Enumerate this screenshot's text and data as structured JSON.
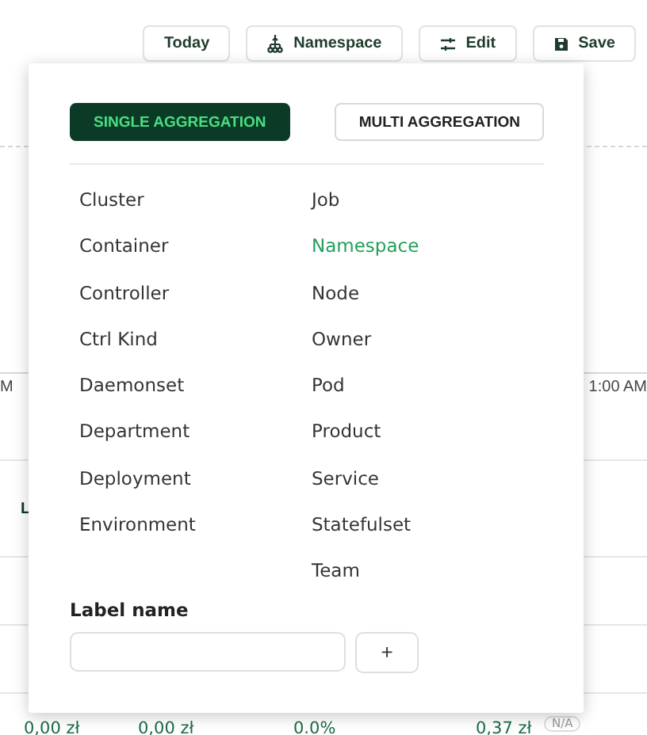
{
  "toolbar": [
    {
      "label": "Today"
    },
    {
      "label": "Namespace"
    },
    {
      "label": "Edit"
    },
    {
      "label": "Save"
    }
  ],
  "chart_axis": {
    "left_label": "M",
    "right_label": "1:00 AM"
  },
  "table": {
    "rows": [
      {
        "cells": [
          "L"
        ]
      },
      {
        "cells": [
          "0,00 zł",
          "0,00 zł",
          "0.0%",
          "0,37 zł"
        ],
        "badge": "N/A"
      }
    ]
  },
  "popup": {
    "modes": [
      {
        "label": "SINGLE AGGREGATION",
        "selected": true
      },
      {
        "label": "MULTI AGGREGATION",
        "selected": false
      }
    ],
    "columns": [
      [
        {
          "label": "Cluster",
          "selected": false
        },
        {
          "label": "Container",
          "selected": false
        },
        {
          "label": "Controller",
          "selected": false
        },
        {
          "label": "Ctrl Kind",
          "selected": false
        },
        {
          "label": "Daemonset",
          "selected": false
        },
        {
          "label": "Department",
          "selected": false
        },
        {
          "label": "Deployment",
          "selected": false
        },
        {
          "label": "Environment",
          "selected": false
        }
      ],
      [
        {
          "label": "Job",
          "selected": false
        },
        {
          "label": "Namespace",
          "selected": true
        },
        {
          "label": "Node",
          "selected": false
        },
        {
          "label": "Owner",
          "selected": false
        },
        {
          "label": "Pod",
          "selected": false
        },
        {
          "label": "Product",
          "selected": false
        },
        {
          "label": "Service",
          "selected": false
        },
        {
          "label": "Statefulset",
          "selected": false
        },
        {
          "label": "Team",
          "selected": false
        }
      ]
    ],
    "label_name": "Label name",
    "add_button": "+"
  }
}
